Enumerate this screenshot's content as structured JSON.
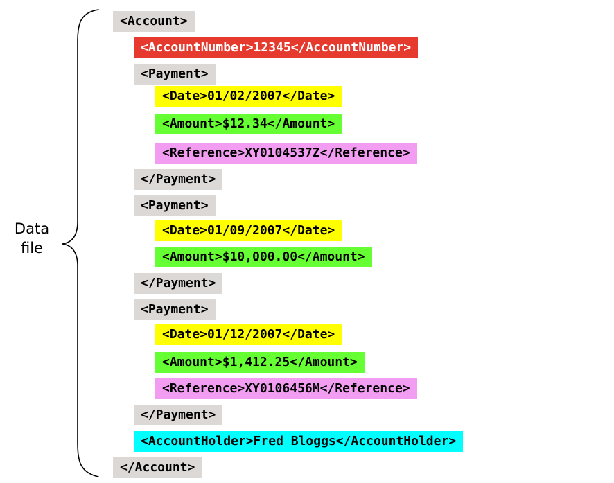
{
  "side_label": {
    "line1": "Data",
    "line2": "file"
  },
  "lines": [
    {
      "text": "<Account>",
      "color": "#dcd8d5"
    },
    {
      "text": "<AccountNumber>12345</AccountNumber>",
      "color": "#e53a2d"
    },
    {
      "text": "<Payment>",
      "color": "#dcd8d5"
    },
    {
      "text": "<Date>01/02/2007</Date>",
      "color": "#ffff00"
    },
    {
      "text": "<Amount>$12.34</Amount>",
      "color": "#66ff33"
    },
    {
      "text": "<Reference>XY0104537Z</Reference>",
      "color": "#f29df2"
    },
    {
      "text": "</Payment>",
      "color": "#dcd8d5"
    },
    {
      "text": "<Payment>",
      "color": "#dcd8d5"
    },
    {
      "text": "<Date>01/09/2007</Date>",
      "color": "#ffff00"
    },
    {
      "text": "<Amount>$10,000.00</Amount>",
      "color": "#66ff33"
    },
    {
      "text": "</Payment>",
      "color": "#dcd8d5"
    },
    {
      "text": "<Payment>",
      "color": "#dcd8d5"
    },
    {
      "text": "<Date>01/12/2007</Date>",
      "color": "#ffff00"
    },
    {
      "text": "<Amount>$1,412.25</Amount>",
      "color": "#66ff33"
    },
    {
      "text": "<Reference>XY0106456M</Reference>",
      "color": "#f29df2"
    },
    {
      "text": "</Payment>",
      "color": "#dcd8d5"
    },
    {
      "text": "<AccountHolder>Fred Bloggs</AccountHolder>",
      "color": "#00ffff"
    },
    {
      "text": "</Account>",
      "color": "#dcd8d5"
    }
  ]
}
